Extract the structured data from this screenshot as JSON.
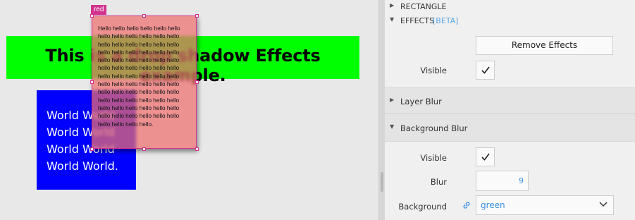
{
  "canvas": {
    "green_text": "This is a drop shadow Effects example.",
    "blue_text": "World World\nWorld World\nWorld World\nWorld World.",
    "red_text": "Hello hello hello hello hello hello hello hello hello hello hello hello hello hello hello hello hello hello hello hello hello hello hello hello hello hello hello hello hello hello hello hello hello hello hello hello hello hello hello hello hello hello hello hello hello hello hello hello hello hello hello hello hello hello hello hello hello hello hello hello hello hello hello hello hello hello hello hello hello hello hello hello hello hello hello hello.",
    "selection_tag": "red",
    "colors": {
      "green": "#00ff00",
      "blue": "#0000ff",
      "red": "#ee6e6e",
      "selection": "#d2338f"
    }
  },
  "panel": {
    "rectangle_label": "RECTANGLE",
    "effects_label": "EFFECTS",
    "effects_badge": "[BETA]",
    "remove_effects_label": "Remove Effects",
    "visible_label": "Visible",
    "visible_checked": true,
    "layer_blur_label": "Layer Blur",
    "background_blur_label": "Background Blur",
    "bg_visible_label": "Visible",
    "bg_visible_checked": true,
    "blur_label": "Blur",
    "blur_value": "9",
    "background_label": "Background",
    "background_value": "green",
    "icons": [
      "triangle-right-icon",
      "triangle-down-icon",
      "checkmark-icon",
      "link-icon",
      "chevron-down-icon"
    ],
    "accent_color": "#3c8fe0"
  }
}
